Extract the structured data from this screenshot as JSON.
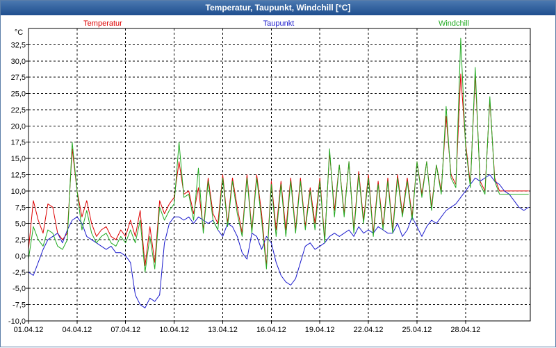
{
  "window": {
    "title": "Temperatur, Taupunkt, Windchill [°C]"
  },
  "chart_data": {
    "type": "line",
    "title": "Temperatur, Taupunkt, Windchill [°C]",
    "ylabel": "°C",
    "xlabel": "",
    "ylim": [
      -10,
      35
    ],
    "xlim": [
      0,
      31
    ],
    "grid": true,
    "legend_position": "top",
    "y_ticks": [
      {
        "v": -10,
        "label": "-10,0"
      },
      {
        "v": -7.5,
        "label": "-7,5"
      },
      {
        "v": -5,
        "label": "-5,0"
      },
      {
        "v": -2.5,
        "label": "-2,5"
      },
      {
        "v": 0,
        "label": "0,0"
      },
      {
        "v": 2.5,
        "label": "2,5"
      },
      {
        "v": 5,
        "label": "5,0"
      },
      {
        "v": 7.5,
        "label": "7,5"
      },
      {
        "v": 10,
        "label": "10,0"
      },
      {
        "v": 12.5,
        "label": "12,5"
      },
      {
        "v": 15,
        "label": "15,0"
      },
      {
        "v": 17.5,
        "label": "17,5"
      },
      {
        "v": 20,
        "label": "20,0"
      },
      {
        "v": 22.5,
        "label": "22,5"
      },
      {
        "v": 25,
        "label": "25,0"
      },
      {
        "v": 27.5,
        "label": "27,5"
      },
      {
        "v": 30,
        "label": "30,0"
      },
      {
        "v": 32.5,
        "label": "32,5"
      }
    ],
    "x_ticks": [
      {
        "day": 0,
        "label": "01.04.12"
      },
      {
        "day": 3,
        "label": "04.04.12"
      },
      {
        "day": 6,
        "label": "07.04.12"
      },
      {
        "day": 9,
        "label": "10.04.12"
      },
      {
        "day": 12,
        "label": "13.04.12"
      },
      {
        "day": 15,
        "label": "16.04.12"
      },
      {
        "day": 18,
        "label": "19.04.12"
      },
      {
        "day": 21,
        "label": "22.04.12"
      },
      {
        "day": 24,
        "label": "25.04.12"
      },
      {
        "day": 27,
        "label": "28.04.12"
      }
    ],
    "series": [
      {
        "name": "Temperatur",
        "color": "#dd0000",
        "x": [
          0,
          0.3,
          0.6,
          0.9,
          1.2,
          1.5,
          1.8,
          2.1,
          2.4,
          2.7,
          3.0,
          3.3,
          3.6,
          3.9,
          4.2,
          4.5,
          4.8,
          5.1,
          5.4,
          5.7,
          6.0,
          6.3,
          6.6,
          6.9,
          7.2,
          7.5,
          7.8,
          8.1,
          8.4,
          8.7,
          9.0,
          9.3,
          9.6,
          9.9,
          10.2,
          10.5,
          10.8,
          11.1,
          11.4,
          11.7,
          12.0,
          12.3,
          12.6,
          12.9,
          13.2,
          13.5,
          13.8,
          14.1,
          14.4,
          14.7,
          15.0,
          15.3,
          15.6,
          15.9,
          16.2,
          16.5,
          16.8,
          17.1,
          17.4,
          17.7,
          18.0,
          18.3,
          18.6,
          18.9,
          19.2,
          19.5,
          19.8,
          20.1,
          20.4,
          20.7,
          21.0,
          21.3,
          21.6,
          21.9,
          22.2,
          22.5,
          22.8,
          23.1,
          23.4,
          23.7,
          24.0,
          24.3,
          24.6,
          24.9,
          25.2,
          25.5,
          25.8,
          26.1,
          26.4,
          26.7,
          27.0,
          27.3,
          27.6,
          27.9,
          28.2,
          28.5,
          28.8,
          29.1,
          29.4,
          29.7,
          30.0,
          30.3,
          30.6,
          30.9
        ],
        "values": [
          1.0,
          8.5,
          5.5,
          3.5,
          8.0,
          7.5,
          3.5,
          2.5,
          3.5,
          16.5,
          10.0,
          6.0,
          8.5,
          5.0,
          3.0,
          4.0,
          4.5,
          3.0,
          2.5,
          4.0,
          3.0,
          5.5,
          3.0,
          7.0,
          -1.5,
          4.5,
          -1.0,
          8.5,
          6.5,
          8.0,
          9.0,
          14.5,
          9.5,
          10.0,
          6.5,
          10.5,
          4.0,
          12.0,
          6.5,
          5.0,
          12.5,
          5.0,
          12.0,
          7.5,
          3.5,
          12.5,
          4.0,
          12.5,
          6.5,
          -1.5,
          11.5,
          4.0,
          11.5,
          4.0,
          12.0,
          4.0,
          12.0,
          4.5,
          10.5,
          5.0,
          12.0,
          2.5,
          16.0,
          7.0,
          14.0,
          6.5,
          14.5,
          4.0,
          13.0,
          5.5,
          12.5,
          3.5,
          11.5,
          4.5,
          12.0,
          4.0,
          12.5,
          6.5,
          12.0,
          6.0,
          14.5,
          9.5,
          14.5,
          7.5,
          14.0,
          10.0,
          21.5,
          12.5,
          11.0,
          28.0,
          17.5,
          11.0,
          28.0,
          11.5,
          10.0,
          24.0,
          12.0,
          10.0,
          10.0,
          10.0,
          10.0,
          10.0,
          10.0,
          10.0
        ],
        "label_x": 147
      },
      {
        "name": "Taupunkt",
        "color": "#1a1acc",
        "x": [
          0,
          0.3,
          0.6,
          0.9,
          1.2,
          1.5,
          1.8,
          2.1,
          2.4,
          2.7,
          3.0,
          3.3,
          3.6,
          3.9,
          4.2,
          4.5,
          4.8,
          5.1,
          5.4,
          5.7,
          6.0,
          6.3,
          6.6,
          6.9,
          7.2,
          7.5,
          7.8,
          8.1,
          8.4,
          8.7,
          9.0,
          9.3,
          9.6,
          9.9,
          10.2,
          10.5,
          10.8,
          11.1,
          11.4,
          11.7,
          12.0,
          12.3,
          12.6,
          12.9,
          13.2,
          13.5,
          13.8,
          14.1,
          14.4,
          14.7,
          15.0,
          15.3,
          15.6,
          15.9,
          16.2,
          16.5,
          16.8,
          17.1,
          17.4,
          17.7,
          18.0,
          18.3,
          18.6,
          18.9,
          19.2,
          19.5,
          19.8,
          20.1,
          20.4,
          20.7,
          21.0,
          21.3,
          21.6,
          21.9,
          22.2,
          22.5,
          22.8,
          23.1,
          23.4,
          23.7,
          24.0,
          24.3,
          24.6,
          24.9,
          25.2,
          25.5,
          25.8,
          26.1,
          26.4,
          26.7,
          27.0,
          27.3,
          27.6,
          27.9,
          28.2,
          28.5,
          28.8,
          29.1,
          29.4,
          29.7,
          30.0,
          30.3,
          30.6,
          30.9
        ],
        "values": [
          -2.5,
          -3.0,
          -1.0,
          1.0,
          2.5,
          3.0,
          3.5,
          2.0,
          4.0,
          5.5,
          6.0,
          5.0,
          3.0,
          2.5,
          2.0,
          1.5,
          1.0,
          1.5,
          0.5,
          0.5,
          0.0,
          -1.0,
          -6.0,
          -7.5,
          -8.0,
          -6.5,
          -7.0,
          -6.0,
          2.0,
          5.0,
          6.0,
          6.0,
          5.5,
          6.0,
          5.0,
          6.0,
          5.5,
          5.0,
          5.5,
          4.0,
          3.0,
          5.0,
          4.5,
          3.0,
          0.5,
          -0.5,
          3.5,
          3.0,
          1.0,
          3.0,
          2.0,
          -1.0,
          -3.0,
          -4.0,
          -4.5,
          -3.5,
          -1.0,
          1.5,
          2.0,
          1.0,
          1.5,
          2.0,
          3.0,
          3.5,
          3.0,
          3.5,
          4.0,
          3.0,
          4.5,
          3.5,
          4.0,
          3.5,
          4.5,
          4.0,
          3.5,
          3.5,
          5.0,
          3.0,
          4.0,
          6.0,
          4.5,
          3.0,
          4.5,
          5.5,
          5.0,
          6.0,
          7.0,
          7.5,
          8.0,
          9.0,
          10.0,
          11.0,
          12.0,
          11.5,
          12.0,
          12.5,
          11.5,
          11.0,
          10.0,
          9.5,
          8.5,
          7.5,
          7.0,
          7.5
        ],
        "label_x": 400
      },
      {
        "name": "Windchill",
        "color": "#22aa22",
        "x": [
          0,
          0.3,
          0.6,
          0.9,
          1.2,
          1.5,
          1.8,
          2.1,
          2.4,
          2.7,
          3.0,
          3.3,
          3.6,
          3.9,
          4.2,
          4.5,
          4.8,
          5.1,
          5.4,
          5.7,
          6.0,
          6.3,
          6.6,
          6.9,
          7.2,
          7.5,
          7.8,
          8.1,
          8.4,
          8.7,
          9.0,
          9.3,
          9.6,
          9.9,
          10.2,
          10.5,
          10.8,
          11.1,
          11.4,
          11.7,
          12.0,
          12.3,
          12.6,
          12.9,
          13.2,
          13.5,
          13.8,
          14.1,
          14.4,
          14.7,
          15.0,
          15.3,
          15.6,
          15.9,
          16.2,
          16.5,
          16.8,
          17.1,
          17.4,
          17.7,
          18.0,
          18.3,
          18.6,
          18.9,
          19.2,
          19.5,
          19.8,
          20.1,
          20.4,
          20.7,
          21.0,
          21.3,
          21.6,
          21.9,
          22.2,
          22.5,
          22.8,
          23.1,
          23.4,
          23.7,
          24.0,
          24.3,
          24.6,
          24.9,
          25.2,
          25.5,
          25.8,
          26.1,
          26.4,
          26.7,
          27.0,
          27.3,
          27.6,
          27.9,
          28.2,
          28.5,
          28.8,
          29.1,
          29.4,
          29.7,
          30.0,
          30.3,
          30.6,
          30.9
        ],
        "values": [
          -0.5,
          4.5,
          2.5,
          1.5,
          4.0,
          3.5,
          1.5,
          1.0,
          2.5,
          17.5,
          10.0,
          4.0,
          7.0,
          3.5,
          2.0,
          3.0,
          3.5,
          2.0,
          1.5,
          3.0,
          2.0,
          4.0,
          2.0,
          5.5,
          -2.5,
          3.0,
          -2.0,
          7.5,
          5.5,
          7.0,
          8.0,
          17.5,
          9.0,
          9.5,
          5.5,
          13.5,
          3.5,
          11.5,
          5.5,
          4.0,
          12.0,
          4.5,
          11.5,
          6.5,
          3.0,
          12.0,
          3.5,
          12.0,
          5.5,
          -2.0,
          11.0,
          3.0,
          11.0,
          3.0,
          11.5,
          3.5,
          11.5,
          4.0,
          10.0,
          4.0,
          11.5,
          2.0,
          16.5,
          6.0,
          14.0,
          6.0,
          14.5,
          3.5,
          12.5,
          5.0,
          12.0,
          3.0,
          11.0,
          4.0,
          11.5,
          3.5,
          12.0,
          6.0,
          11.5,
          5.5,
          14.5,
          9.0,
          14.5,
          7.0,
          14.0,
          9.5,
          23.0,
          12.0,
          10.5,
          33.5,
          17.0,
          10.5,
          29.0,
          11.0,
          9.5,
          24.5,
          11.5,
          9.5,
          9.5,
          9.5,
          9.5,
          9.5,
          9.5,
          9.5
        ],
        "label_x": 652
      }
    ]
  }
}
